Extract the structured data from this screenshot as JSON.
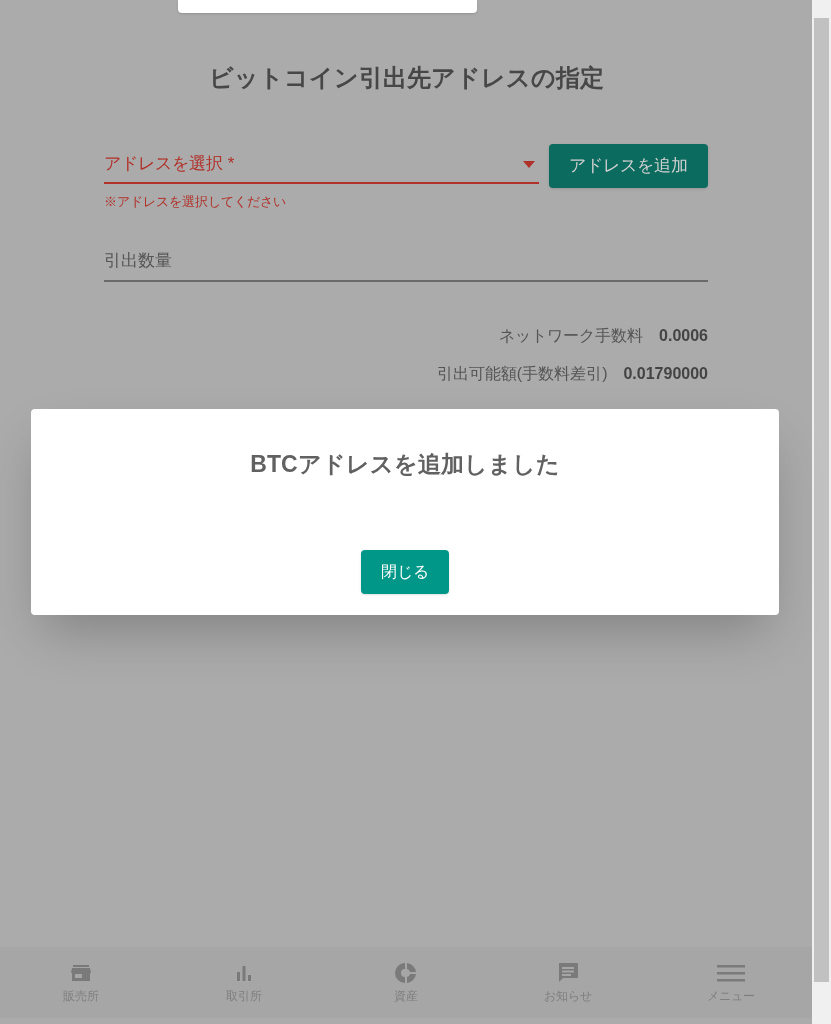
{
  "page": {
    "title": "ビットコイン引出先アドレスの指定"
  },
  "address_select": {
    "label": "アドレスを選択 *",
    "error": "※アドレスを選択してください"
  },
  "add_address_button": "アドレスを追加",
  "amount_field": {
    "placeholder": "引出数量"
  },
  "summary": [
    {
      "label": "ネットワーク手数料",
      "value": "0.0006"
    },
    {
      "label": "引出可能額(手数料差引)",
      "value": "0.01790000"
    }
  ],
  "dialog": {
    "message": "BTCアドレスを追加しました",
    "button": "閉じる"
  },
  "bottom_nav": [
    {
      "kind": "store",
      "label": "販売所"
    },
    {
      "kind": "chart",
      "label": "取引所"
    },
    {
      "kind": "pie",
      "label": "資産"
    },
    {
      "kind": "message",
      "label": "お知らせ"
    },
    {
      "kind": "menu",
      "label": "メニュー"
    }
  ]
}
